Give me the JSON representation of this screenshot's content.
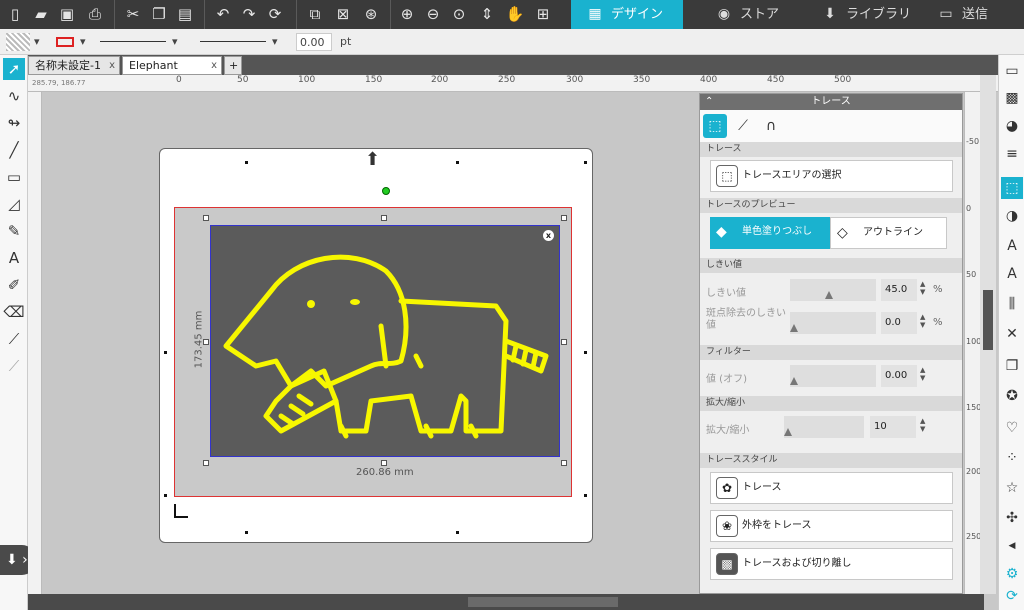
{
  "topbar": {
    "tabs": [
      {
        "label": "デザイン",
        "icon": "grid-icon",
        "active": true
      },
      {
        "label": "ストア",
        "icon": "store-icon",
        "active": false
      },
      {
        "label": "ライブラリ",
        "icon": "library-icon",
        "active": false
      },
      {
        "label": "送信",
        "icon": "send-icon",
        "active": false
      }
    ]
  },
  "propbar": {
    "line_weight": "0.00",
    "line_unit": "pt"
  },
  "doc_tabs": [
    {
      "label": "名称未設定-1",
      "close": "x"
    },
    {
      "label": "Elephant",
      "close": "x"
    }
  ],
  "add_tab": "+",
  "ruler": {
    "coords": "285.79, 186.77",
    "h_labels": [
      "0",
      "50",
      "100",
      "150",
      "200",
      "250",
      "300",
      "350",
      "400",
      "450",
      "500"
    ],
    "r_labels": [
      "-50",
      "0",
      "50",
      "100",
      "150",
      "200",
      "250"
    ]
  },
  "canvas": {
    "width_dim": "260.86 mm",
    "height_dim": "173.45 mm",
    "close_badge": "x"
  },
  "panel": {
    "title": "トレース",
    "sec_trace": "トレース",
    "btn_select_area": "トレースエリアの選択",
    "sec_preview": "トレースのプレビュー",
    "btn_fill": "単色塗りつぶし",
    "btn_outline": "アウトライン",
    "sec_threshold": "しきい値",
    "threshold_label": "しきい値",
    "threshold_value": "45.0",
    "threshold_unit": "%",
    "speckle_label": "斑点除去のしきい値",
    "speckle_value": "0.0",
    "speckle_unit": "%",
    "sec_filter": "フィルター",
    "filter_label": "値 (オフ)",
    "filter_value": "0.00",
    "sec_scale": "拡大/縮小",
    "scale_label": "拡大/縮小",
    "scale_value": "10",
    "sec_style": "トレーススタイル",
    "style_trace": "トレース",
    "style_outer": "外枠をトレース",
    "style_detach": "トレースおよび切り離し",
    "threshold_level": 45,
    "speckle_level": 0,
    "filter_level": 0,
    "scale_level": 0
  },
  "colors": {
    "accent": "#1ab2cf",
    "trace_line": "#f7f700",
    "toolbar_bg": "#3a3a3a"
  }
}
